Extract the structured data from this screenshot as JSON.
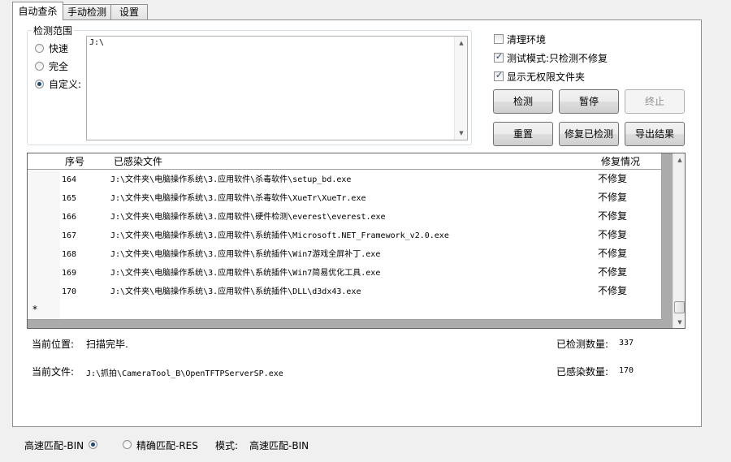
{
  "tabs": [
    {
      "label": "自动查杀",
      "active": true
    },
    {
      "label": "手动检测",
      "active": false
    },
    {
      "label": "设置",
      "active": false
    }
  ],
  "scope": {
    "title": "检测范围",
    "options": [
      {
        "label": "快速",
        "selected": false
      },
      {
        "label": "完全",
        "selected": false
      },
      {
        "label": "自定义:",
        "selected": true
      }
    ],
    "custom_path": "J:\\"
  },
  "checkboxes": [
    {
      "label": "清理环境",
      "checked": false
    },
    {
      "label": "测试模式:只检测不修复",
      "checked": true
    },
    {
      "label": "显示无权限文件夹",
      "checked": true
    }
  ],
  "buttons": {
    "detect": "检测",
    "pause": "暂停",
    "stop": "终止",
    "reset": "重置",
    "repair_detected": "修复已检测",
    "export_results": "导出结果"
  },
  "grid": {
    "columns": [
      "序号",
      "已感染文件",
      "修复情况"
    ],
    "rows": [
      {
        "id": "164",
        "file": "J:\\文件夹\\电脑操作系统\\3.应用软件\\杀毒软件\\setup_bd.exe",
        "status": "不修复"
      },
      {
        "id": "165",
        "file": "J:\\文件夹\\电脑操作系统\\3.应用软件\\杀毒软件\\XueTr\\XueTr.exe",
        "status": "不修复"
      },
      {
        "id": "166",
        "file": "J:\\文件夹\\电脑操作系统\\3.应用软件\\硬件检测\\everest\\everest.exe",
        "status": "不修复"
      },
      {
        "id": "167",
        "file": "J:\\文件夹\\电脑操作系统\\3.应用软件\\系统插件\\Microsoft.NET_Framework_v2.0.exe",
        "status": "不修复"
      },
      {
        "id": "168",
        "file": "J:\\文件夹\\电脑操作系统\\3.应用软件\\系统插件\\Win7游戏全屏补丁.exe",
        "status": "不修复"
      },
      {
        "id": "169",
        "file": "J:\\文件夹\\电脑操作系统\\3.应用软件\\系统插件\\Win7简易优化工具.exe",
        "status": "不修复"
      },
      {
        "id": "170",
        "file": "J:\\文件夹\\电脑操作系统\\3.应用软件\\系统插件\\DLL\\d3dx43.exe",
        "status": "不修复"
      }
    ],
    "new_row_marker": "*"
  },
  "status": {
    "position_label": "当前位置:",
    "position_value": "扫描完毕.",
    "file_label": "当前文件:",
    "file_value": "J:\\抓拍\\CameraTool_B\\OpenTFTPServerSP.exe",
    "detected_label": "已检测数量:",
    "detected_value": "337",
    "infected_label": "已感染数量:",
    "infected_value": "170"
  },
  "footer": {
    "fast_match": "高速匹配-BIN",
    "fast_selected": true,
    "exact_match": "精确匹配-RES",
    "exact_selected": false,
    "mode_label": "模式:",
    "mode_value": "高速匹配-BIN"
  }
}
